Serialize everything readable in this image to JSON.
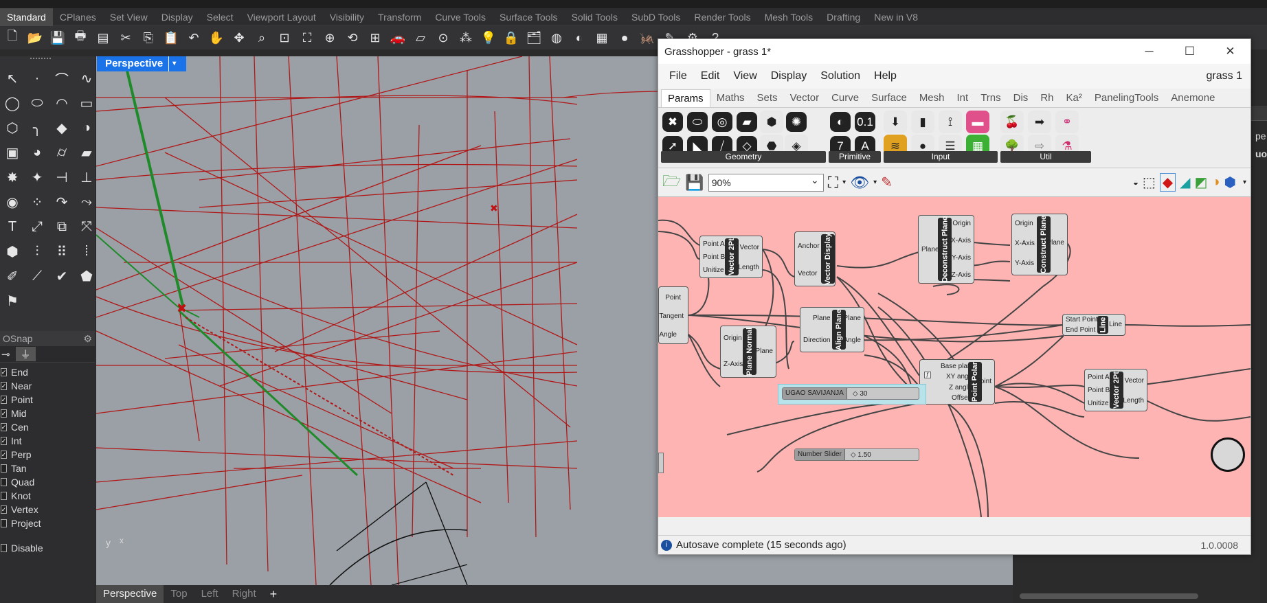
{
  "rhino": {
    "tabs": [
      "Standard",
      "CPlanes",
      "Set View",
      "Display",
      "Select",
      "Viewport Layout",
      "Visibility",
      "Transform",
      "Curve Tools",
      "Surface Tools",
      "Solid Tools",
      "SubD Tools",
      "Render Tools",
      "Mesh Tools",
      "Drafting",
      "New in V8"
    ],
    "active_tab": "Standard",
    "viewport_label": "Perspective",
    "viewport_tabs": [
      "Perspective",
      "Top",
      "Left",
      "Right",
      "+"
    ],
    "osnap": {
      "title": "OSnap",
      "items": [
        {
          "label": "End",
          "checked": true
        },
        {
          "label": "Near",
          "checked": true
        },
        {
          "label": "Point",
          "checked": true
        },
        {
          "label": "Mid",
          "checked": true
        },
        {
          "label": "Cen",
          "checked": true
        },
        {
          "label": "Int",
          "checked": true
        },
        {
          "label": "Perp",
          "checked": true
        },
        {
          "label": "Tan",
          "checked": false
        },
        {
          "label": "Quad",
          "checked": false
        },
        {
          "label": "Knot",
          "checked": false
        },
        {
          "label": "Vertex",
          "checked": true
        },
        {
          "label": "Project",
          "checked": false
        }
      ],
      "disable": "Disable"
    },
    "axis": {
      "y": "y",
      "x": "x"
    },
    "right_text": [
      "pe",
      "uou"
    ]
  },
  "gh": {
    "title": "Grasshopper - grass 1*",
    "window_controls": [
      "─",
      "☐",
      "✕"
    ],
    "menu": [
      "File",
      "Edit",
      "View",
      "Display",
      "Solution",
      "Help"
    ],
    "doc_name": "grass 1",
    "tabs": [
      "Params",
      "Maths",
      "Sets",
      "Vector",
      "Curve",
      "Surface",
      "Mesh",
      "Int",
      "Trns",
      "Dis",
      "Rh",
      "Ka²",
      "PanelingTools",
      "Anemone"
    ],
    "active_tab": "Params",
    "ribbon_groups": [
      "Geometry",
      "Primitive",
      "Input",
      "Util"
    ],
    "zoom": "90%",
    "components": {
      "vector2pt_a": {
        "name": "Vector 2Pt",
        "inputs": [
          "Point A",
          "Point B",
          "Unitize"
        ],
        "outputs": [
          "Vector",
          "Length"
        ]
      },
      "vector_display": {
        "name": "Vector Display",
        "inputs": [
          "Anchor",
          "Vector"
        ]
      },
      "deconstruct_plane": {
        "name": "Deconstruct Plane",
        "inputs": [
          "Plane"
        ],
        "outputs": [
          "Origin",
          "X-Axis",
          "Y-Axis",
          "Z-Axis"
        ]
      },
      "construct_plane": {
        "name": "Construct Plane",
        "inputs": [
          "Origin",
          "X-Axis",
          "Y-Axis"
        ],
        "outputs": [
          "Plane"
        ]
      },
      "left_partial": {
        "outputs": [
          "Point",
          "Tangent",
          "Angle"
        ]
      },
      "align_plane": {
        "name": "Align Plane",
        "inputs": [
          "Plane",
          "Direction"
        ],
        "outputs": [
          "Plane",
          "Angle"
        ]
      },
      "plane_normal": {
        "name": "Plane Normal",
        "inputs": [
          "Origin",
          "Z-Axis"
        ],
        "outputs": [
          "Plane"
        ]
      },
      "line": {
        "name": "Line",
        "inputs": [
          "Start Point",
          "End Point"
        ],
        "outputs": [
          "Line"
        ]
      },
      "point_polar": {
        "name": "Point Polar",
        "inputs": [
          "Base plane",
          "XY angle",
          "Z angle",
          "Offset"
        ],
        "outputs": [
          "Point"
        ]
      },
      "vector2pt_b": {
        "name": "Vector 2Pt",
        "inputs": [
          "Point A",
          "Point B",
          "Unitize"
        ],
        "outputs": [
          "Vector",
          "Length"
        ]
      }
    },
    "sliders": [
      {
        "label": "UGAO SAVIJANJA",
        "value": "30"
      },
      {
        "label": "Number Slider",
        "value": "1.50"
      }
    ],
    "status": "Autosave complete (15 seconds ago)",
    "version": "1.0.0008"
  }
}
